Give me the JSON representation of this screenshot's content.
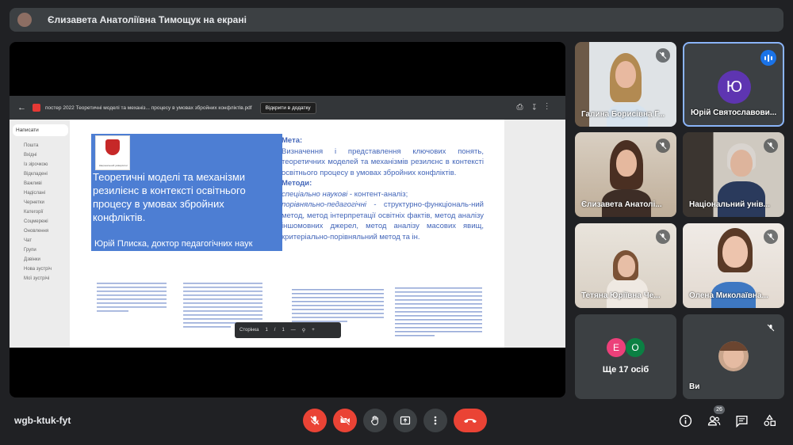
{
  "banner": {
    "text": "Єлизавета Анатоліївна Тимощук на екрані"
  },
  "pdf": {
    "filename": "постер 2022 Теоретичні моделі та механіз... процесу в умовах збройних конфліктів.pdf",
    "open_with": "Відкрити в додатку",
    "page_label": "Сторінка",
    "page_current": "1",
    "page_sep": "/",
    "page_total": "1"
  },
  "mail_nav": {
    "compose": "Написати",
    "items": [
      "Пошта",
      "Вхідні",
      "Із зірочкою",
      "Відкладені",
      "Важливі",
      "Надіслані",
      "Чернетки",
      "Категорії",
      "Соцмережі",
      "Оновлення",
      "Чат",
      "Групи",
      "Дзвінки",
      "Нова зустріч",
      "Мої зустрічі"
    ]
  },
  "poster": {
    "title": "Теоретичні моделі та механізми резилієнс в контексті освітнього процесу в умовах збройних конфліктів.",
    "author": "Юрій Плиска, доктор педагогічних наук",
    "goal_heading": "Мета:",
    "goal_text": "Визначення і представлення ключових понять, теоретичних моделей та механізмів резилєнс в контексті освітнього процесу в умовах збройних конфліктів.",
    "methods_heading": "Методи:",
    "method1_italic": "спеціально наукові",
    "method1_rest": " - контент-аналіз;",
    "method2_italic": "порівняльно-педагогічні",
    "method2_rest": " - структурно-функціональ-ний метод, метод інтерпретації освітніх фактів, метод аналізу іншомовних джерел, метод аналізу масових явищ, критеріально-порівняльний метод та ін.",
    "logo_text": "Національний університет"
  },
  "participants": [
    {
      "name": "Галина Борисівна Г...",
      "muted": true
    },
    {
      "name": "Юрій Святославови...",
      "initial": "Ю",
      "speaking": true
    },
    {
      "name": "Єлизавета Анатолі...",
      "muted": true
    },
    {
      "name": "Національний унів...",
      "muted": true
    },
    {
      "name": "Тетяна Юріївна Че...",
      "muted": true
    },
    {
      "name": "Олена Миколаївна...",
      "muted": true
    }
  ],
  "others": {
    "label": "Ще 17 осіб",
    "av1": "Е",
    "av2": "О"
  },
  "self": {
    "label": "Ви"
  },
  "meeting_code": "wgb-ktuk-fyt",
  "people_count": "26",
  "colors": {
    "end_call": "#ea4335",
    "speaking": "#1a73e8",
    "poster_blue": "#4d7ed3"
  }
}
